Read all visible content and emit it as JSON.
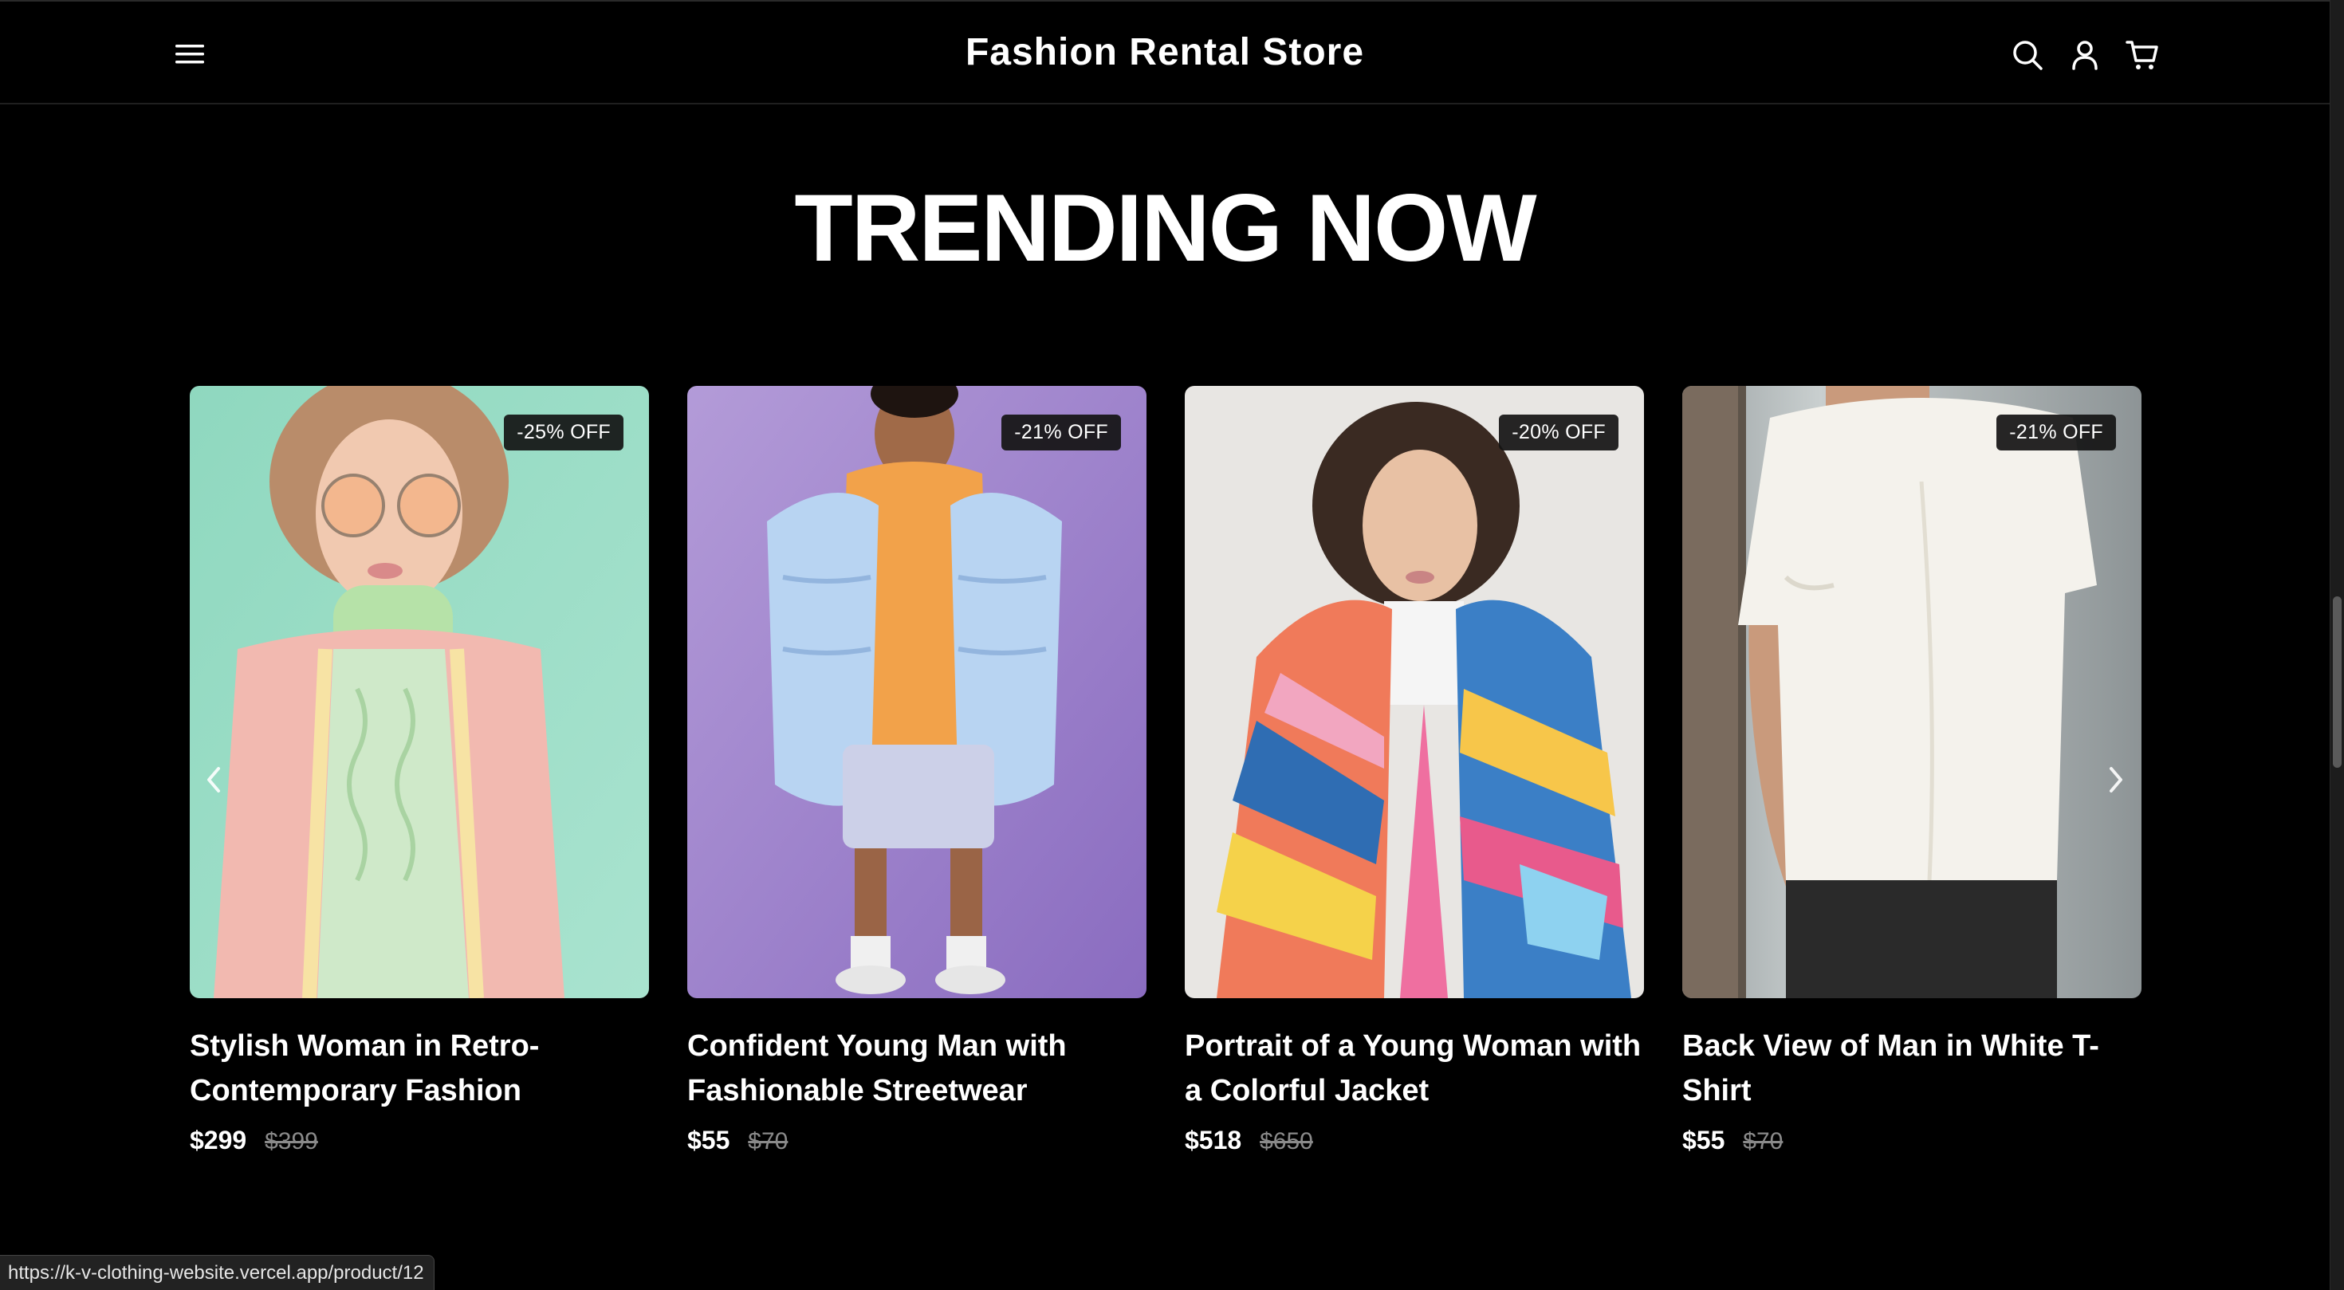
{
  "header": {
    "title": "Fashion Rental Store",
    "icons": [
      "menu-icon",
      "search-icon",
      "user-icon",
      "cart-icon"
    ]
  },
  "section": {
    "title": "TRENDING NOW"
  },
  "products": [
    {
      "title": "Stylish Woman in Retro-Contemporary Fashion",
      "badge": "-25% OFF",
      "price": "$299",
      "old_price": "$399",
      "image_palette": "mint-green background, pink cardigan"
    },
    {
      "title": "Confident Young Man with Fashionable Streetwear",
      "badge": "-21% OFF",
      "price": "$55",
      "old_price": "$70",
      "image_palette": "purple background, light blue puffer jacket"
    },
    {
      "title": "Portrait of a Young Woman with a Colorful Jacket",
      "badge": "-20% OFF",
      "price": "$518",
      "old_price": "$650",
      "image_palette": "light grey background, multicolor windbreaker"
    },
    {
      "title": "Back View of Man in White T-Shirt",
      "badge": "-21% OFF",
      "price": "$55",
      "old_price": "$70",
      "image_palette": "grey window background, white t-shirt"
    }
  ],
  "carousel": {
    "prev_icon": "chevron-left-icon",
    "next_icon": "chevron-right-icon"
  },
  "status_bar": {
    "url": "https://k-v-clothing-website.vercel.app/product/12"
  },
  "colors": {
    "background": "#000000",
    "text": "#ffffff",
    "muted": "#8a8a8a",
    "badge_bg": "#141414"
  }
}
